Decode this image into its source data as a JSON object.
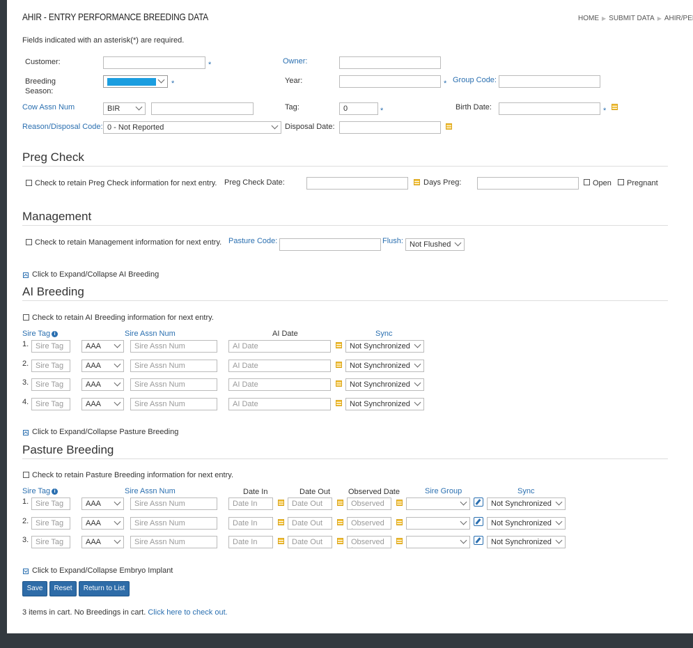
{
  "header": {
    "title": "AHIR - ENTRY PERFORMANCE BREEDING DATA",
    "breadcrumbs": [
      "HOME",
      "SUBMIT DATA",
      "AHIR/PER"
    ]
  },
  "required_note": "Fields indicated with an asterisk(*) are required.",
  "form": {
    "customer_label": "Customer:",
    "owner_label": "Owner:",
    "breeding_season_label": "Breeding Season:",
    "year_label": "Year:",
    "group_code_label": "Group Code:",
    "cow_assn_num_label": "Cow Assn Num",
    "cow_assn_breed_value": "BIR",
    "tag_label": "Tag:",
    "tag_value": "0",
    "birth_date_label": "Birth Date:",
    "reason_label": "Reason/Disposal Code:",
    "reason_value": "0 - Not Reported",
    "disposal_date_label": "Disposal Date:",
    "asterisk": "*"
  },
  "preg_check": {
    "heading": "Preg Check",
    "retain_label": "Check to retain Preg Check information for next entry.",
    "date_label": "Preg Check Date:",
    "days_label": "Days Preg:",
    "open_label": "Open",
    "pregnant_label": "Pregnant"
  },
  "management": {
    "heading": "Management",
    "retain_label": "Check to retain Management information for next entry.",
    "pasture_label": "Pasture Code:",
    "flush_label": "Flush:",
    "flush_value": "Not Flushed"
  },
  "ai": {
    "toggle_label": "Click to Expand/Collapse AI Breeding",
    "heading": "AI Breeding",
    "retain_label": "Check to retain AI Breeding information for next entry.",
    "col_sire_tag": "Sire Tag",
    "col_sire_assn": "Sire Assn Num",
    "col_ai_date": "AI Date",
    "col_sync": "Sync",
    "rows": [
      {
        "num": "1.",
        "sire_tag_ph": "Sire Tag",
        "breed": "AAA",
        "assn_ph": "Sire Assn Num",
        "date_ph": "AI Date",
        "sync": "Not Synchronized"
      },
      {
        "num": "2.",
        "sire_tag_ph": "Sire Tag",
        "breed": "AAA",
        "assn_ph": "Sire Assn Num",
        "date_ph": "AI Date",
        "sync": "Not Synchronized"
      },
      {
        "num": "3.",
        "sire_tag_ph": "Sire Tag",
        "breed": "AAA",
        "assn_ph": "Sire Assn Num",
        "date_ph": "AI Date",
        "sync": "Not Synchronized"
      },
      {
        "num": "4.",
        "sire_tag_ph": "Sire Tag",
        "breed": "AAA",
        "assn_ph": "Sire Assn Num",
        "date_ph": "AI Date",
        "sync": "Not Synchronized"
      }
    ]
  },
  "pasture": {
    "toggle_label": "Click to Expand/Collapse Pasture Breeding",
    "heading": "Pasture Breeding",
    "retain_label": "Check to retain Pasture Breeding information for next entry.",
    "col_sire_tag": "Sire Tag",
    "col_sire_assn": "Sire Assn Num",
    "col_date_in": "Date In",
    "col_date_out": "Date Out",
    "col_observed": "Observed Date",
    "col_sire_group": "Sire Group",
    "col_sync": "Sync",
    "rows": [
      {
        "num": "1.",
        "sire_tag_ph": "Sire Tag",
        "breed": "AAA",
        "assn_ph": "Sire Assn Num",
        "in_ph": "Date In",
        "out_ph": "Date Out",
        "obs_ph": "Observed I",
        "sync": "Not Synchronized"
      },
      {
        "num": "2.",
        "sire_tag_ph": "Sire Tag",
        "breed": "AAA",
        "assn_ph": "Sire Assn Num",
        "in_ph": "Date In",
        "out_ph": "Date Out",
        "obs_ph": "Observed I",
        "sync": "Not Synchronized"
      },
      {
        "num": "3.",
        "sire_tag_ph": "Sire Tag",
        "breed": "AAA",
        "assn_ph": "Sire Assn Num",
        "in_ph": "Date In",
        "out_ph": "Date Out",
        "obs_ph": "Observed I",
        "sync": "Not Synchronized"
      }
    ]
  },
  "embryo": {
    "toggle_label": "Click to Expand/Collapse Embryo Implant"
  },
  "buttons": {
    "save": "Save",
    "reset": "Reset",
    "return": "Return to List"
  },
  "cart": {
    "text": "3 items in cart. No Breedings in cart.",
    "link": "Click here to check out."
  }
}
